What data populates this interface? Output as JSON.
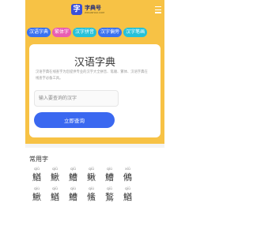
{
  "header": {
    "logo_badge": "字",
    "logo_title": "字典号",
    "logo_subtitle": "ZIDIANHAO.COM"
  },
  "nav_pills": [
    {
      "label": "汉语字典",
      "color": "#3a72f0"
    },
    {
      "label": "繁体字",
      "color": "#e85db3"
    },
    {
      "label": "汉字拼音",
      "color": "#26c1d8"
    },
    {
      "label": "汉字偏旁",
      "color": "#3a72f0"
    },
    {
      "label": "汉字笔画",
      "color": "#26c1d8"
    }
  ],
  "search_card": {
    "title": "汉语字典",
    "description": "汉语字典在线查字为您提供专业的汉字大全拼音、笔顺、繁体、汉语字典在线查字必备工具。",
    "input_placeholder": "输入要查询的汉字",
    "input_value": "",
    "button_label": "立即查询"
  },
  "common_chars": {
    "title": "常用字",
    "items": [
      {
        "pinyin": "qiū",
        "char": "鰌"
      },
      {
        "pinyin": "qiū",
        "char": "鰍"
      },
      {
        "pinyin": "qiū",
        "char": "鰽"
      },
      {
        "pinyin": "qiū",
        "char": "鳅"
      },
      {
        "pinyin": "qiú",
        "char": "鰽"
      },
      {
        "pinyin": "xiū",
        "char": "鵂"
      },
      {
        "pinyin": "qiú",
        "char": "鰍"
      },
      {
        "pinyin": "qiū",
        "char": "鰌"
      },
      {
        "pinyin": "qiú",
        "char": "鰽"
      },
      {
        "pinyin": "qiú",
        "char": "鯈"
      },
      {
        "pinyin": "qiū",
        "char": "鶖"
      },
      {
        "pinyin": "qiū",
        "char": "鰌"
      }
    ]
  },
  "colors": {
    "accent_yellow": "#f7c245",
    "primary_blue": "#3a68f0",
    "background": "#f4f4f4"
  }
}
